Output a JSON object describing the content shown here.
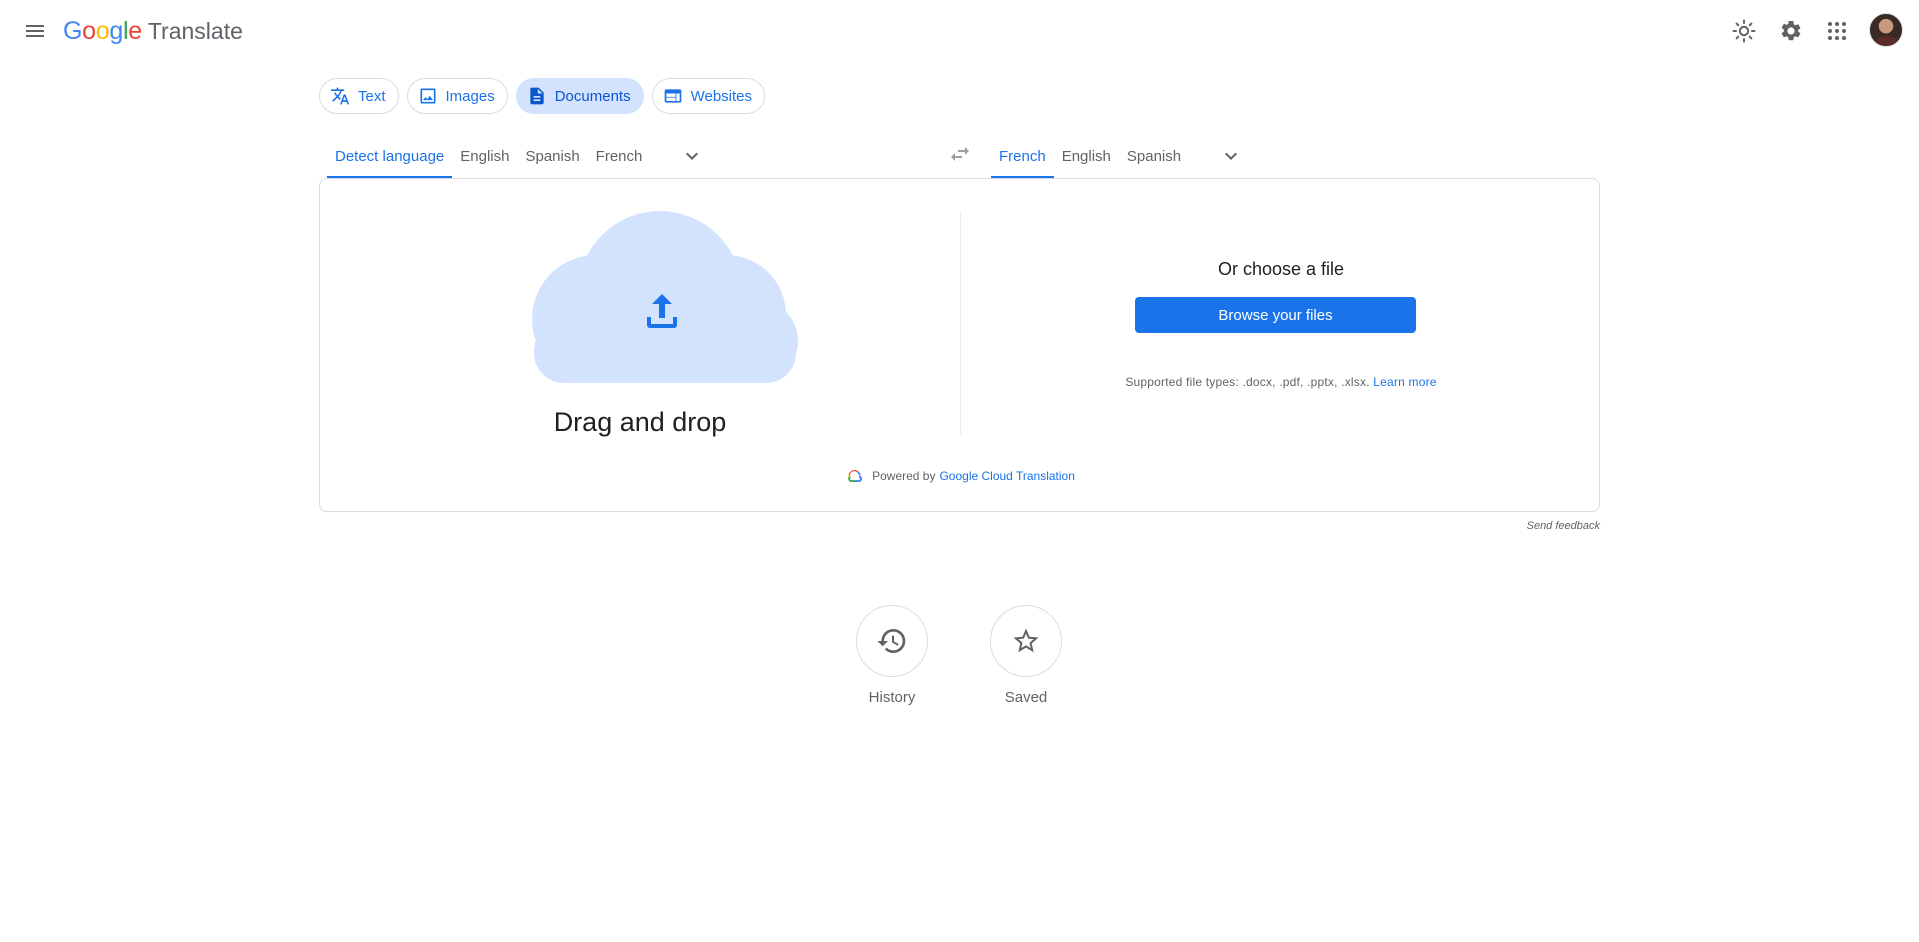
{
  "header": {
    "logo_text": "Google",
    "product_name": "Translate",
    "icons": {
      "menu": "menu-icon",
      "theme": "sun-icon",
      "settings": "gear-icon",
      "apps": "apps-grid-icon"
    }
  },
  "modes": [
    {
      "label": "Text",
      "active": false,
      "icon": "translate-icon"
    },
    {
      "label": "Images",
      "active": false,
      "icon": "image-icon"
    },
    {
      "label": "Documents",
      "active": true,
      "icon": "document-icon"
    },
    {
      "label": "Websites",
      "active": false,
      "icon": "web-icon"
    }
  ],
  "source_langs": [
    "Detect language",
    "English",
    "Spanish",
    "French"
  ],
  "source_active_index": 0,
  "target_langs": [
    "French",
    "English",
    "Spanish"
  ],
  "target_active_index": 0,
  "upload": {
    "drag_label": "Drag and drop",
    "choose_title": "Or choose a file",
    "browse_label": "Browse your files",
    "supported_prefix": "Supported file types: .docx, .pdf, .pptx, .xlsx.",
    "learn_more": "Learn more"
  },
  "powered": {
    "prefix": "Powered by",
    "link": "Google Cloud Translation"
  },
  "feedback_label": "Send feedback",
  "bottom": {
    "history_label": "History",
    "saved_label": "Saved"
  },
  "colors": {
    "accent": "#1a73e8",
    "active_chip_bg": "#d3e3fd",
    "cloud": "#d3e3fd"
  }
}
